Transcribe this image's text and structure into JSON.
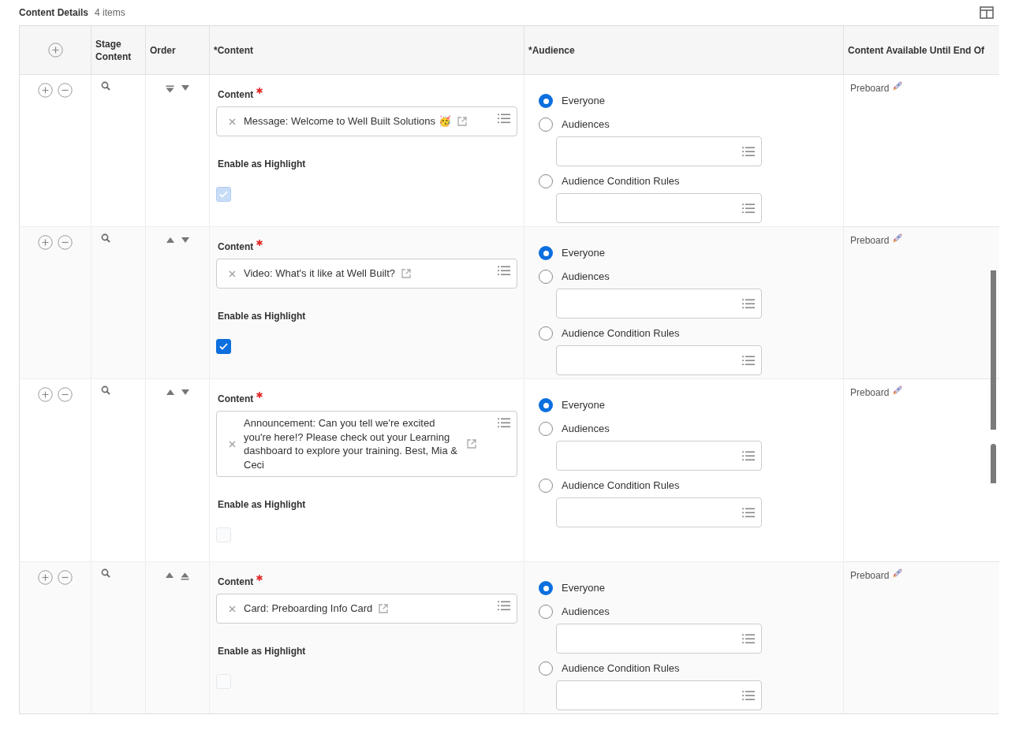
{
  "header": {
    "title": "Content Details",
    "count": "4 items"
  },
  "table": {
    "columns": [
      {
        "label": "Stage Content"
      },
      {
        "label": "Order"
      },
      {
        "label": "*Content"
      },
      {
        "label": "*Audience"
      },
      {
        "label": "Content Available Until End Of"
      }
    ],
    "rows": [
      {
        "order": [
          {
            "kind": "to-bottom"
          },
          {
            "kind": "down"
          }
        ],
        "content_label": "Content",
        "content": "Message: Welcome to Well Built Solutions 🥳",
        "highlight_label": "Enable as Highlight",
        "highlight": {
          "checked": true,
          "disabled": true
        },
        "audience": [
          {
            "label": "Everyone",
            "selected": true,
            "kind": "plain"
          },
          {
            "label": "Audiences",
            "selected": false,
            "kind": "with-field"
          },
          {
            "label": "Audience Condition Rules",
            "selected": false,
            "kind": "with-field"
          }
        ],
        "available": "Preboard"
      },
      {
        "order": [
          {
            "kind": "up"
          },
          {
            "kind": "down"
          }
        ],
        "content_label": "Content",
        "content": "Video: What's it like at Well Built?",
        "highlight_label": "Enable as Highlight",
        "highlight": {
          "checked": true,
          "disabled": false
        },
        "audience": [
          {
            "label": "Everyone",
            "selected": true,
            "kind": "plain"
          },
          {
            "label": "Audiences",
            "selected": false,
            "kind": "with-field"
          },
          {
            "label": "Audience Condition Rules",
            "selected": false,
            "kind": "with-field"
          }
        ],
        "available": "Preboard"
      },
      {
        "order": [
          {
            "kind": "up"
          },
          {
            "kind": "down"
          }
        ],
        "content_label": "Content",
        "content": "Announcement: Can you tell we're excited you're here!? Please check out your Learning dashboard to explore your training. Best, Mia & Ceci",
        "highlight_label": "Enable as Highlight",
        "highlight": {
          "checked": false,
          "disabled": true
        },
        "audience": [
          {
            "label": "Everyone",
            "selected": true,
            "kind": "plain"
          },
          {
            "label": "Audiences",
            "selected": false,
            "kind": "with-field"
          },
          {
            "label": "Audience Condition Rules",
            "selected": false,
            "kind": "with-field"
          }
        ],
        "available": "Preboard"
      },
      {
        "order": [
          {
            "kind": "up"
          },
          {
            "kind": "to-top"
          }
        ],
        "content_label": "Content",
        "content": "Card: Preboarding Info Card",
        "highlight_label": "Enable as Highlight",
        "highlight": {
          "checked": false,
          "disabled": true
        },
        "audience": [
          {
            "label": "Everyone",
            "selected": true,
            "kind": "plain"
          },
          {
            "label": "Audiences",
            "selected": false,
            "kind": "with-field"
          },
          {
            "label": "Audience Condition Rules",
            "selected": false,
            "kind": "with-field"
          }
        ],
        "available": "Preboard"
      }
    ]
  }
}
